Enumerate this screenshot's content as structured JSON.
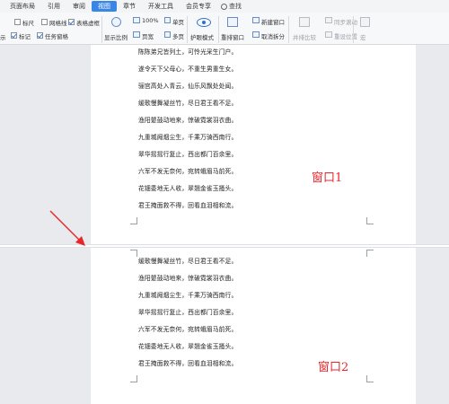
{
  "menu": {
    "tabs": [
      "页面布局",
      "引用",
      "审阅",
      "视图",
      "章节",
      "开发工具",
      "会员专享"
    ],
    "active_tab": "视图",
    "search_label": "查找"
  },
  "ribbon": {
    "checks": {
      "ruler": "标尺",
      "gridlines": "网格线",
      "table_virtual": "表格虚框",
      "marks": "标记",
      "task_pane": "任务窗格"
    },
    "left_cut": "示",
    "zoom_percent": "100%",
    "page_width": "页宽",
    "single_page": "单页",
    "multi_page": "多页",
    "display_ratio": "显示比例",
    "eye_mode": "护眼模式",
    "rearrange_window": "重排窗口",
    "new_window": "新建窗口",
    "cancel_split": "取消拆分",
    "side_compare": "并排比较",
    "sync_scroll": "同步滚动",
    "reset_position": "重设位置",
    "macro": "宏"
  },
  "window1": {
    "label": "窗口1",
    "lines": [
      "陈陈弟兄皆列土，可怜光采生门户。",
      "遂令天下父母心，不重生男重生女。",
      "骊宫高处入青云，仙乐风飘处处闻。",
      "缓歌慢舞凝丝竹，尽日君王看不足。",
      "渔阳鼙鼓动地来，惊破霓裳羽衣曲。",
      "九重城阙烟尘生，千乘万骑西南行。",
      "翠华摇摇行复止，西出都门百余里。",
      "六军不发无奈何，宛转蛾眉马前死。",
      "花钿委地无人收，翠翘金雀玉搔头。",
      "君王掩面救不得，回看血泪相和流。"
    ]
  },
  "window2": {
    "label": "窗口2",
    "lines": [
      "缓歌慢舞凝丝竹，尽日君王看不足。",
      "渔阳鼙鼓动地来，惊破霓裳羽衣曲。",
      "九重城阙烟尘生，千乘万骑西南行。",
      "翠华摇摇行复止，西出都门百余里。",
      "六军不发无奈何，宛转蛾眉马前死。",
      "花钿委地无人收，翠翘金雀玉搔头。",
      "君王掩面救不得，回看血泪相和流。"
    ]
  },
  "colors": {
    "accent": "#3a86e6",
    "annotation_red": "#e8262a"
  }
}
